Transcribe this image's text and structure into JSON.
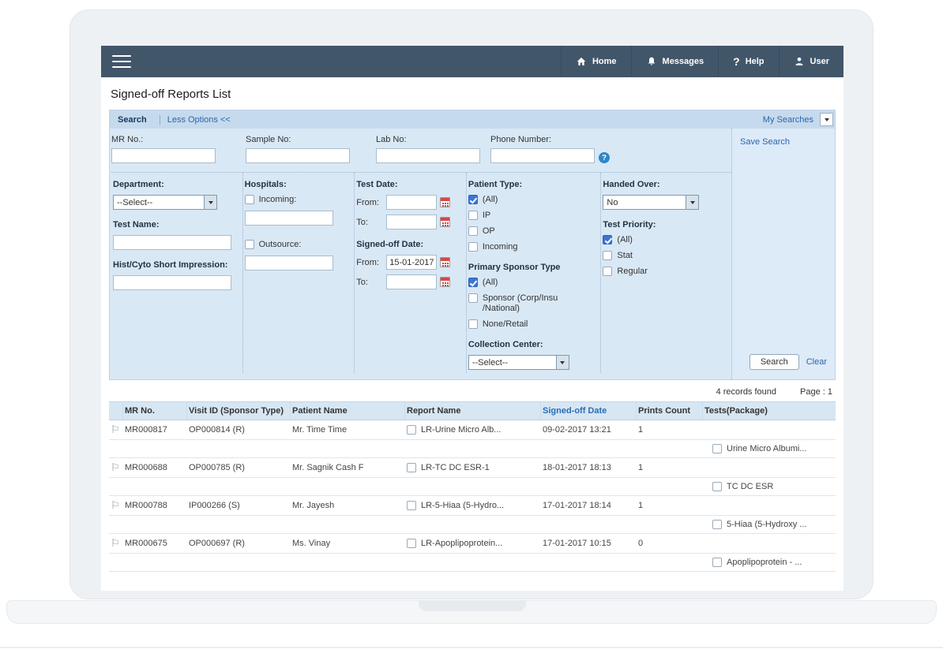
{
  "nav": {
    "items": [
      {
        "label": "Home",
        "icon": "home-icon"
      },
      {
        "label": "Messages",
        "icon": "bell-icon"
      },
      {
        "label": "Help",
        "icon": "question-icon"
      },
      {
        "label": "User",
        "icon": "user-icon"
      }
    ]
  },
  "page": {
    "title": "Signed-off Reports List"
  },
  "search": {
    "header": {
      "title": "Search",
      "toggle": "Less Options <<",
      "my_searches": "My Searches"
    },
    "save_search": "Save Search",
    "mr_no": {
      "label": "MR No.:",
      "value": ""
    },
    "sample_no": {
      "label": "Sample No:",
      "value": ""
    },
    "lab_no": {
      "label": "Lab No:",
      "value": ""
    },
    "phone": {
      "label": "Phone Number:",
      "value": ""
    },
    "department": {
      "label": "Department:",
      "value": "--Select--"
    },
    "test_name": {
      "label": "Test Name:",
      "value": ""
    },
    "hist_cyto": {
      "label": "Hist/Cyto Short Impression:",
      "value": ""
    },
    "hospitals": {
      "label": "Hospitals:",
      "incoming_label": "Incoming:",
      "incoming_value": "",
      "outsource_label": "Outsource:",
      "outsource_value": ""
    },
    "test_date": {
      "label": "Test Date:",
      "from_label": "From:",
      "to_label": "To:",
      "from_value": "",
      "to_value": ""
    },
    "signed_off_date": {
      "label": "Signed-off Date:",
      "from_label": "From:",
      "to_label": "To:",
      "from_value": "15-01-2017",
      "to_value": ""
    },
    "patient_type": {
      "label": "Patient Type:",
      "options": [
        {
          "label": "(All)",
          "checked": true
        },
        {
          "label": "IP",
          "checked": false
        },
        {
          "label": "OP",
          "checked": false
        },
        {
          "label": "Incoming",
          "checked": false
        }
      ]
    },
    "primary_sponsor": {
      "label": "Primary Sponsor Type",
      "options": [
        {
          "label": "(All)",
          "checked": true
        },
        {
          "label": "Sponsor (Corp/Insu /National)",
          "checked": false
        },
        {
          "label": "None/Retail",
          "checked": false
        }
      ]
    },
    "collection_center": {
      "label": "Collection Center:",
      "value": "--Select--"
    },
    "handed_over": {
      "label": "Handed Over:",
      "value": "No"
    },
    "test_priority": {
      "label": "Test Priority:",
      "options": [
        {
          "label": "(All)",
          "checked": true
        },
        {
          "label": "Stat",
          "checked": false
        },
        {
          "label": "Regular",
          "checked": false
        }
      ]
    },
    "actions": {
      "search": "Search",
      "clear": "Clear"
    }
  },
  "results": {
    "count": "4 records found",
    "page": "Page : 1",
    "columns": [
      "MR No.",
      "Visit ID (Sponsor Type)",
      "Patient Name",
      "Report Name",
      "Signed-off Date",
      "Prints Count",
      "Tests(Package)"
    ],
    "rows": [
      {
        "mr_no": "MR000817",
        "visit_id": "OP000814 (R)",
        "patient": "Mr. Time Time",
        "report": "LR-Urine Micro Alb...",
        "signed_off": "09-02-2017 13:21",
        "prints": "1",
        "test": "Urine Micro Albumi..."
      },
      {
        "mr_no": "MR000688",
        "visit_id": "OP000785 (R)",
        "patient": "Mr. Sagnik Cash F",
        "report": "LR-TC DC ESR-1",
        "signed_off": "18-01-2017 18:13",
        "prints": "1",
        "test": "TC DC ESR"
      },
      {
        "mr_no": "MR000788",
        "visit_id": "IP000266 (S)",
        "patient": "Mr. Jayesh",
        "report": "LR-5-Hiaa (5-Hydro...",
        "signed_off": "17-01-2017 18:14",
        "prints": "1",
        "test": "5-Hiaa (5-Hydroxy ..."
      },
      {
        "mr_no": "MR000675",
        "visit_id": "OP000697 (R)",
        "patient": "Ms. Vinay",
        "report": "LR-Apoplipoprotein...",
        "signed_off": "17-01-2017 10:15",
        "prints": "0",
        "test": "Apoplipoprotein - ..."
      }
    ]
  }
}
